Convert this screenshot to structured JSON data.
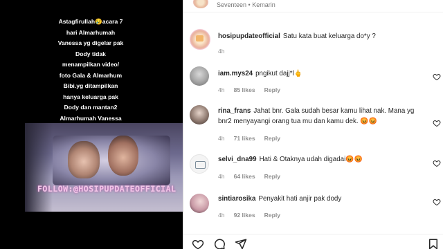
{
  "post": {
    "caption_lines": [
      "Astagfirullah😢acara 7",
      "hari Almarhumah",
      "Vanessa yg digelar pak",
      "Dody tidak",
      "menampilkan video/",
      "foto Gala & Almarhum",
      "Bibi.yg ditampilkan",
      "hanya keluarga pak",
      "Dody dan mantan2",
      "Almarhumah Vanessa",
      "😢"
    ],
    "watermark": "FOLLOW:@HOSIPUPDATEOFFICIAL"
  },
  "topbar": {
    "meta": "Seventeen • Kemarin"
  },
  "main_comment": {
    "user": "hosipupdateofficial",
    "text": "Satu kata buat keluarga do*y ?",
    "time": "4h"
  },
  "comments": [
    {
      "user": "iam.mys24",
      "text": "pngikut dajj*l🖕",
      "time": "4h",
      "likes": "85 likes",
      "reply": "Reply"
    },
    {
      "user": "rina_frans",
      "text": "Jahat bnr. Gala sudah besar kamu lihat nak. Mana yg bnr2 menyayangi orang tua mu dan kamu dek. 😡😡",
      "time": "4h",
      "likes": "71 likes",
      "reply": "Reply"
    },
    {
      "user": "selvi_dna99",
      "text": "Hati & Otaknya udah digadai😡😡",
      "time": "4h",
      "likes": "64 likes",
      "reply": "Reply"
    },
    {
      "user": "sintiarosika",
      "text": "Penyakit hati anjir pak dody",
      "time": "4h",
      "likes": "92 likes",
      "reply": "Reply"
    }
  ],
  "colors": {
    "text": "#262626",
    "muted": "#8e8e8e"
  }
}
